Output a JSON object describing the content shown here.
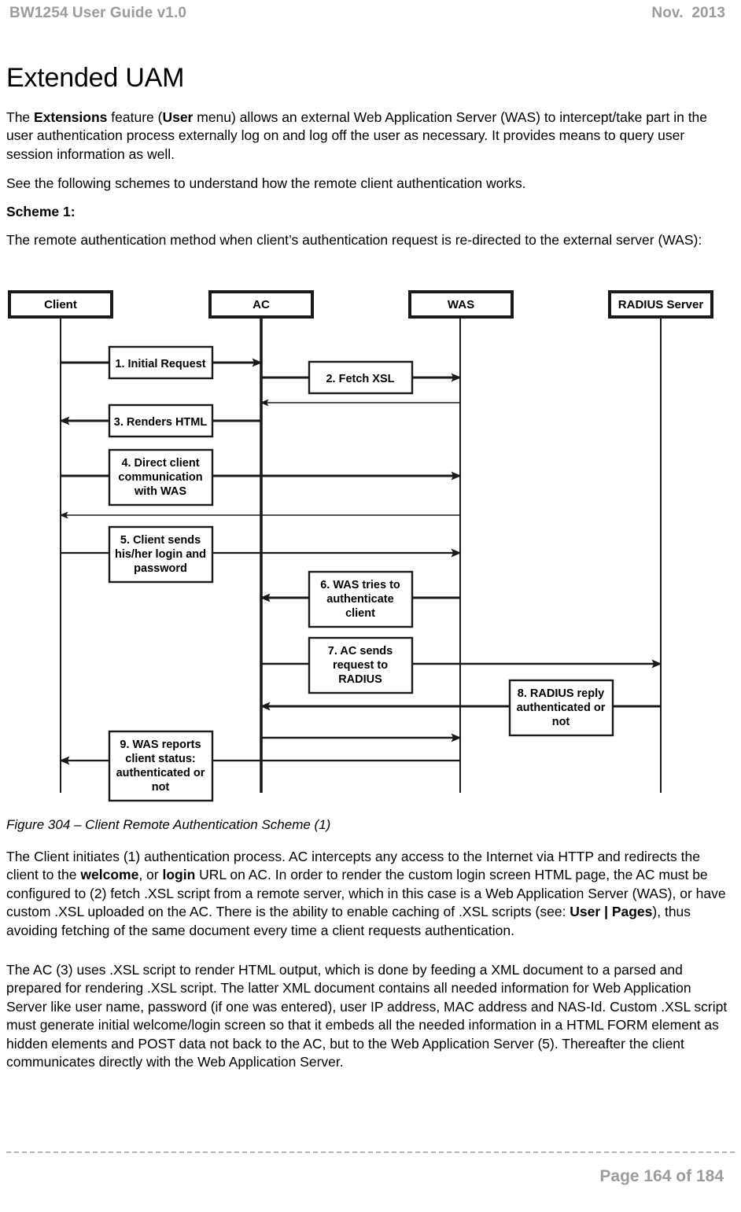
{
  "header": {
    "left": "BW1254 User Guide v1.0",
    "right": "Nov.  2013"
  },
  "title": "Extended UAM",
  "paragraphs": {
    "p1_a": "The ",
    "p1_b1": "Extensions",
    "p1_c": " feature (",
    "p1_b2": "User",
    "p1_d": " menu) allows an external Web Application Server (WAS) to intercept/take part in the user authentication process externally log on and log off the user as necessary. It provides means to query user session information as well.",
    "p2": "See the following schemes to understand how the remote client authentication works.",
    "p3": "Scheme 1:",
    "p4": "The remote authentication method when client’s authentication request is re-directed to the external server (WAS):",
    "p5_a": "The Client initiates (1) authentication process. AC intercepts any access to the Internet via HTTP and redirects the client to the ",
    "p5_b1": "welcome",
    "p5_c": ", or ",
    "p5_b2": "login",
    "p5_d": " URL on AC. In order to render the custom login screen HTML page, the AC must be configured to (2) fetch .XSL script from a remote server, which in this case is a Web Application Server (WAS), or have custom .XSL uploaded on the AC. There is the ability to enable caching of .XSL scripts (see: ",
    "p5_b3": "User | Pages",
    "p5_e": "), thus avoiding fetching of the same document every time a client requests authentication.",
    "p6": "The AC (3) uses .XSL script to render HTML output, which is done by feeding a XML document to a parsed and prepared for rendering .XSL script. The latter XML document contains all needed information for Web Application Server like user name, password (if one was entered), user IP address, MAC address and NAS-Id. Custom .XSL script must generate initial welcome/login screen so that it embeds all the needed information in a HTML FORM element as hidden elements and POST data not back to the AC, but to the Web Application Server (5). Thereafter the client communicates directly with the Web Application Server."
  },
  "figure": {
    "caption": "Figure 304  – Client Remote Authentication Scheme (1)",
    "lifelines": [
      {
        "id": "client",
        "label": "Client"
      },
      {
        "id": "ac",
        "label": "AC"
      },
      {
        "id": "was",
        "label": "WAS"
      },
      {
        "id": "radius",
        "label": "RADIUS Server"
      }
    ],
    "messages": [
      {
        "id": "m1",
        "label": "1. Initial Request"
      },
      {
        "id": "m2",
        "label": "2. Fetch XSL"
      },
      {
        "id": "m3",
        "label": "3. Renders HTML"
      },
      {
        "id": "m4",
        "label": "4. Direct client communication with WAS"
      },
      {
        "id": "m4l1",
        "label": "4. Direct client"
      },
      {
        "id": "m4l2",
        "label": "communication"
      },
      {
        "id": "m4l3",
        "label": "with WAS"
      },
      {
        "id": "m5",
        "label": "5. Client sends his/her login and password"
      },
      {
        "id": "m5l1",
        "label": "5. Client sends"
      },
      {
        "id": "m5l2",
        "label": "his/her login and"
      },
      {
        "id": "m5l3",
        "label": "password"
      },
      {
        "id": "m6",
        "label": "6. WAS tries to authenticate client"
      },
      {
        "id": "m6l1",
        "label": "6. WAS tries to"
      },
      {
        "id": "m6l2",
        "label": "authenticate"
      },
      {
        "id": "m6l3",
        "label": "client"
      },
      {
        "id": "m7",
        "label": "7. AC sends request to RADIUS"
      },
      {
        "id": "m7l1",
        "label": "7. AC sends"
      },
      {
        "id": "m7l2",
        "label": "request to"
      },
      {
        "id": "m7l3",
        "label": "RADIUS"
      },
      {
        "id": "m8",
        "label": "8. RADIUS reply authenticated or not"
      },
      {
        "id": "m8l1",
        "label": "8. RADIUS reply"
      },
      {
        "id": "m8l2",
        "label": "authenticated or"
      },
      {
        "id": "m8l3",
        "label": "not"
      },
      {
        "id": "m9",
        "label": "9. WAS reports client status: authenticated or not"
      },
      {
        "id": "m9l1",
        "label": "9. WAS reports"
      },
      {
        "id": "m9l2",
        "label": "client status:"
      },
      {
        "id": "m9l3",
        "label": "authenticated or"
      },
      {
        "id": "m9l4",
        "label": "not"
      }
    ]
  },
  "footer": {
    "page": "Page 164 of 184"
  },
  "colors": {
    "header_gray": "#9c9c9c",
    "text": "#000000",
    "line": "#1a1a1a",
    "background": "#ffffff"
  }
}
